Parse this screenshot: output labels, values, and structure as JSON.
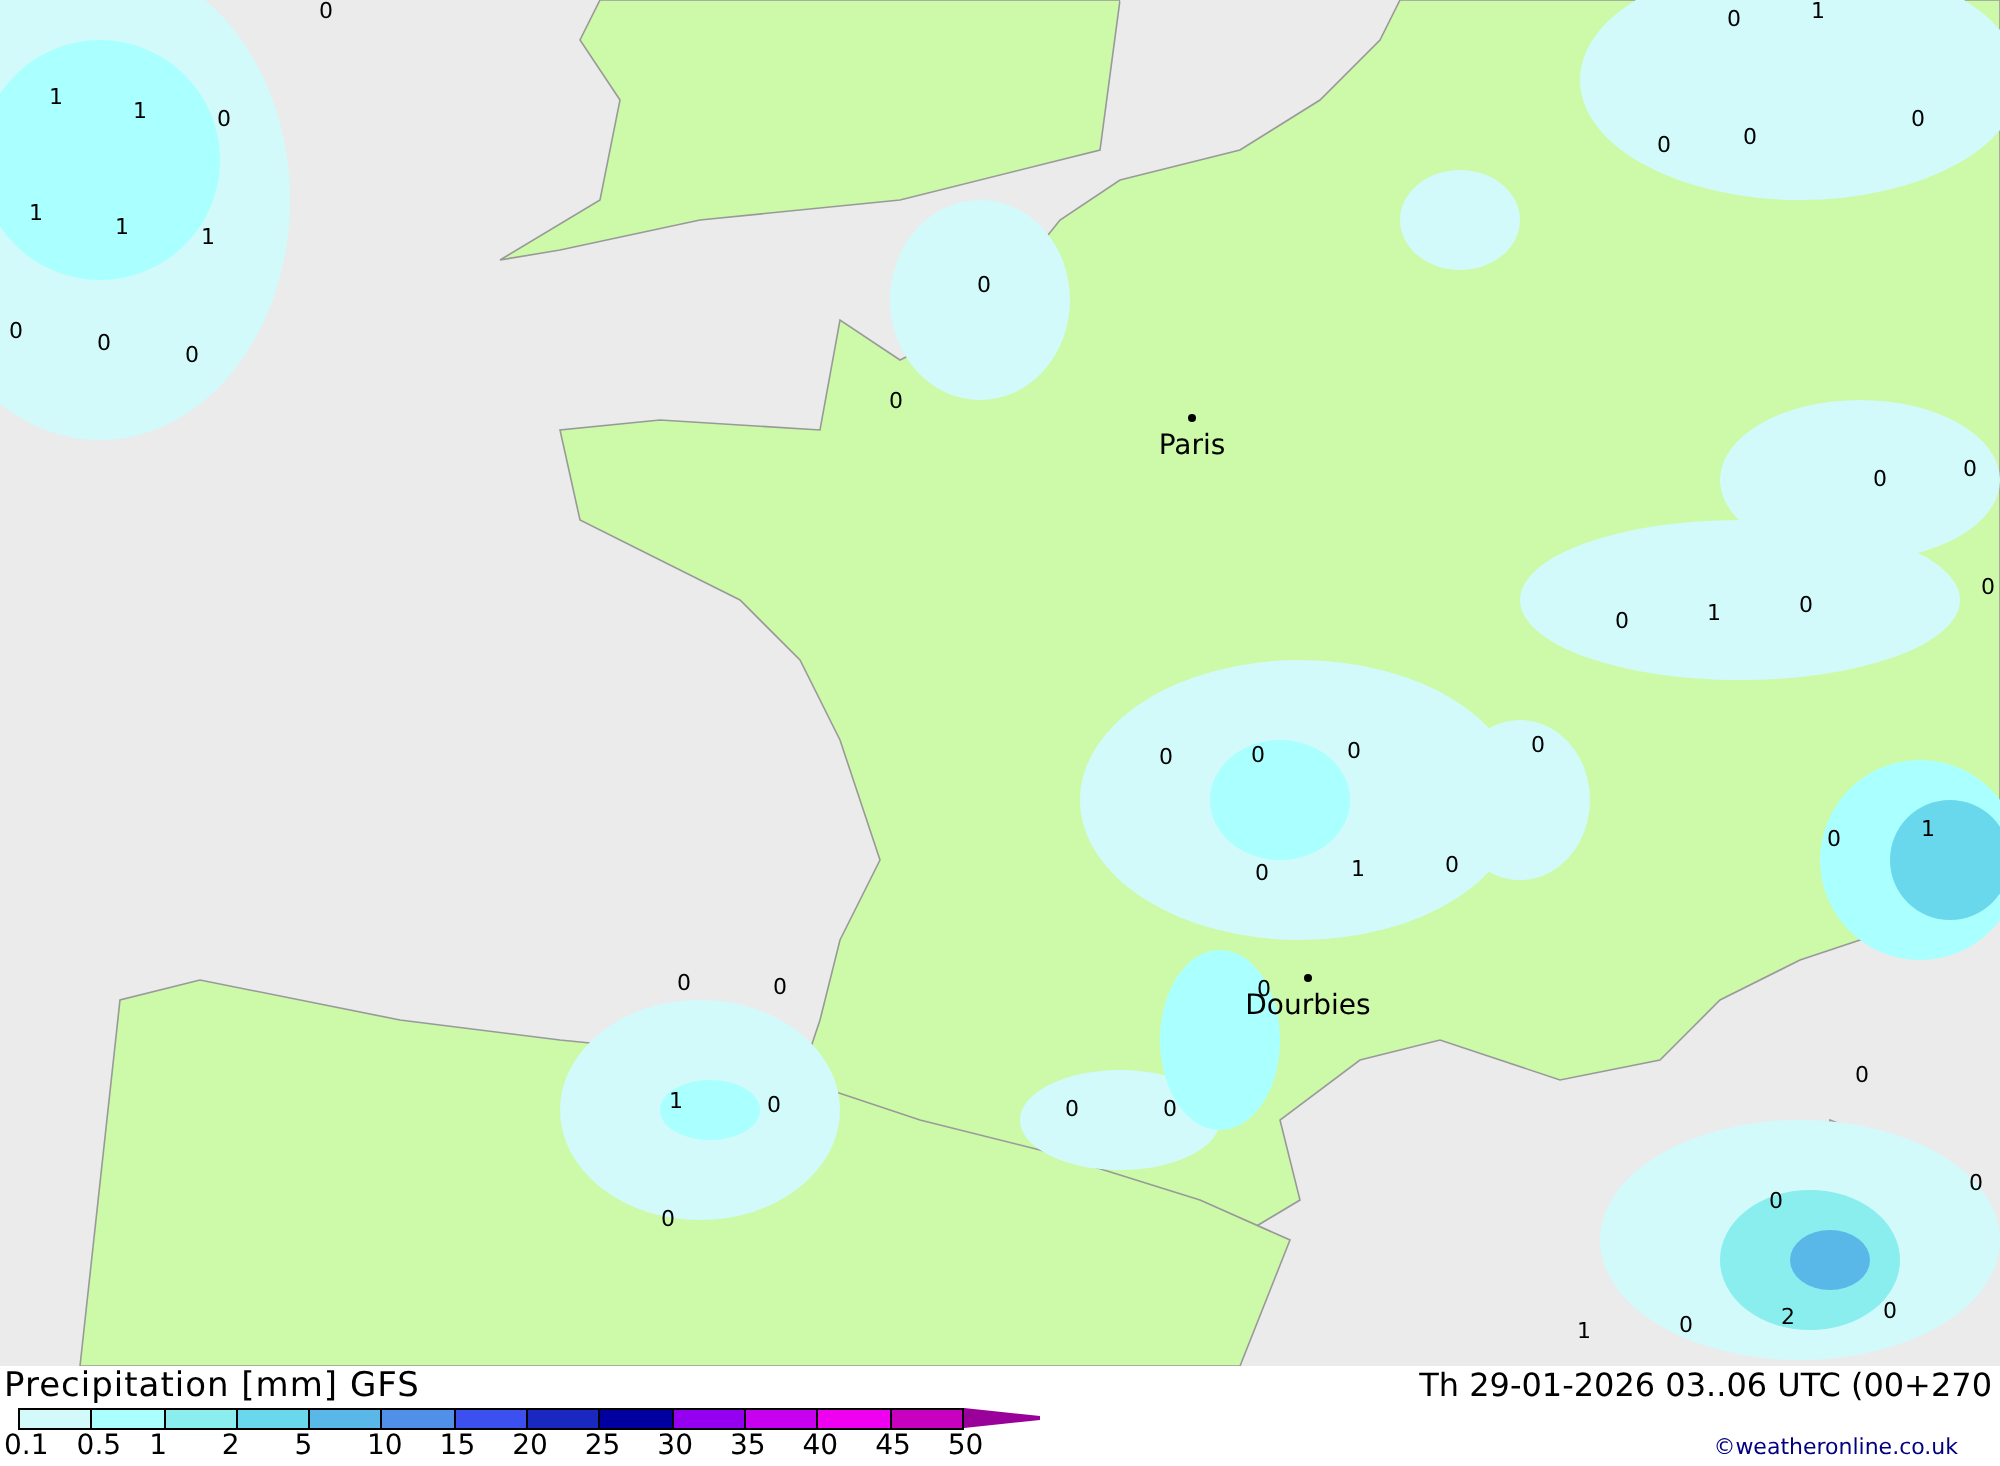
{
  "map": {
    "values": [
      "1",
      "1",
      "0",
      "1",
      "1",
      "1",
      "0",
      "0",
      "0",
      "0",
      "0",
      "0",
      "0",
      "1",
      "0",
      "0",
      "0",
      "0",
      "0",
      "0",
      "1",
      "0",
      "0",
      "0",
      "0",
      "0",
      "0",
      "0",
      "1",
      "0",
      "0",
      "1",
      "0",
      "0",
      "0",
      "1",
      "0",
      "0",
      "0",
      "0",
      "0",
      "0",
      "0",
      "1",
      "0",
      "2",
      "0"
    ],
    "cities": [
      {
        "name": "Paris"
      },
      {
        "name": "Dourbies"
      }
    ]
  },
  "legend": {
    "title": "Precipitation [mm] GFS",
    "bins": [
      {
        "kind": "box",
        "color": "#d2fafa"
      },
      {
        "kind": "box",
        "color": "#aaffff"
      },
      {
        "kind": "box",
        "color": "#8aeeee"
      },
      {
        "kind": "box",
        "color": "#6ad8ec"
      },
      {
        "kind": "box",
        "color": "#5ab8e8"
      },
      {
        "kind": "box",
        "color": "#5090e8"
      },
      {
        "kind": "box",
        "color": "#3c50f0"
      },
      {
        "kind": "box",
        "color": "#1828c0"
      },
      {
        "kind": "box",
        "color": "#0000a0"
      },
      {
        "kind": "box",
        "color": "#9600f0"
      },
      {
        "kind": "box",
        "color": "#c800f0"
      },
      {
        "kind": "box",
        "color": "#f000f0"
      },
      {
        "kind": "box",
        "color": "#c800c0"
      },
      {
        "kind": "arrow",
        "color": "#9a009a"
      }
    ],
    "ticks": [
      "0.1",
      "0.5",
      "1",
      "2",
      "5",
      "10",
      "15",
      "20",
      "25",
      "30",
      "35",
      "40",
      "45",
      "50"
    ]
  },
  "valid_time": "Th 29-01-2026 03..06 UTC (00+270",
  "credit": "©weatheronline.co.uk"
}
